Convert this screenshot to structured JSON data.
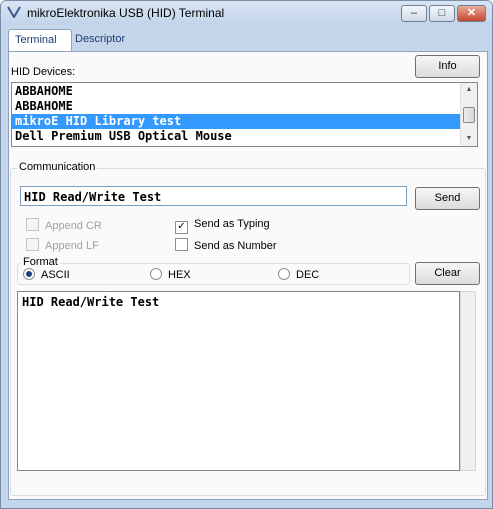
{
  "window": {
    "title": "mikroElektronika USB (HID) Terminal",
    "buttons": {
      "minimize": "–",
      "maximize": "□",
      "close": "✕"
    }
  },
  "tabs": [
    {
      "label": "Terminal",
      "active": true
    },
    {
      "label": "Descriptor",
      "active": false
    }
  ],
  "devices": {
    "label": "HID Devices:",
    "info_button": "Info",
    "items": [
      {
        "name": "ABBAHOME",
        "selected": false
      },
      {
        "name": "ABBAHOME",
        "selected": false
      },
      {
        "name": "mikroE HID Library test",
        "selected": true
      },
      {
        "name": "Dell Premium USB Optical Mouse",
        "selected": false
      }
    ]
  },
  "communication": {
    "label": "Communication",
    "input_value": "HID Read/Write Test",
    "send_button": "Send",
    "append_cr": {
      "label": "Append CR",
      "checked": false,
      "enabled": false
    },
    "append_lf": {
      "label": "Append LF",
      "checked": false,
      "enabled": false
    },
    "send_as_typing": {
      "label": "Send as Typing",
      "checked": true
    },
    "send_as_number": {
      "label": "Send as Number",
      "checked": false
    },
    "format": {
      "label": "Format",
      "options": [
        {
          "label": "ASCII",
          "selected": true
        },
        {
          "label": "HEX",
          "selected": false
        },
        {
          "label": "DEC",
          "selected": false
        }
      ]
    },
    "clear_button": "Clear",
    "output_text": "HID Read/Write Test"
  },
  "colors": {
    "selection": "#3399ff",
    "chrome": "#c6d6ea"
  }
}
